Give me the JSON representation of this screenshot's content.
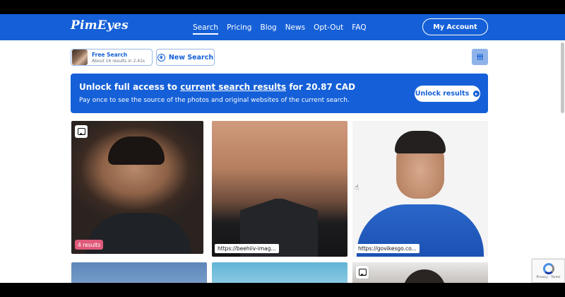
{
  "header": {
    "logo": "PimEyes",
    "nav": [
      "Search",
      "Pricing",
      "Blog",
      "News",
      "Opt-Out",
      "FAQ"
    ],
    "account_label": "My Account"
  },
  "search_bar": {
    "free_search_title": "Free Search",
    "free_search_sub": "About 16 results in 2.41s",
    "new_search_label": "New Search"
  },
  "banner": {
    "title_prefix": "Unlock full access to",
    "title_link": "current search results",
    "title_suffix": "for 20.87 CAD",
    "subtitle": "Pay once to see the source of the photos and original websites of the current search.",
    "button_label": "Unlock results"
  },
  "results": [
    {
      "badge": "4 results"
    },
    {
      "url": "https://beehiiv-imag..."
    },
    {
      "url": "https://govikesgo.co..."
    }
  ],
  "recaptcha": {
    "text": "Privacy - Terms"
  },
  "colors": {
    "brand": "#1560d8",
    "badge": "#e05a7a"
  },
  "icons": [
    "image-icon",
    "plus-circle-icon",
    "grid-icon",
    "arrow-right-icon",
    "cursor-icon",
    "recaptcha-icon"
  ]
}
